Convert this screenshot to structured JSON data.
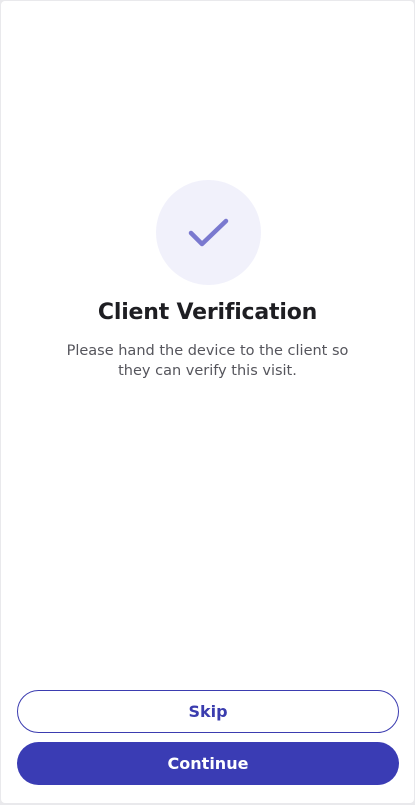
{
  "screen": {
    "title": "Client Verification",
    "message": "Please hand the device to the client so they can verify this visit.",
    "icon": "checkmark-icon"
  },
  "actions": {
    "skip_label": "Skip",
    "continue_label": "Continue"
  },
  "colors": {
    "accent": "#3a3cb4",
    "icon_bg": "#f1f1fb",
    "check": "#7a79cf"
  }
}
